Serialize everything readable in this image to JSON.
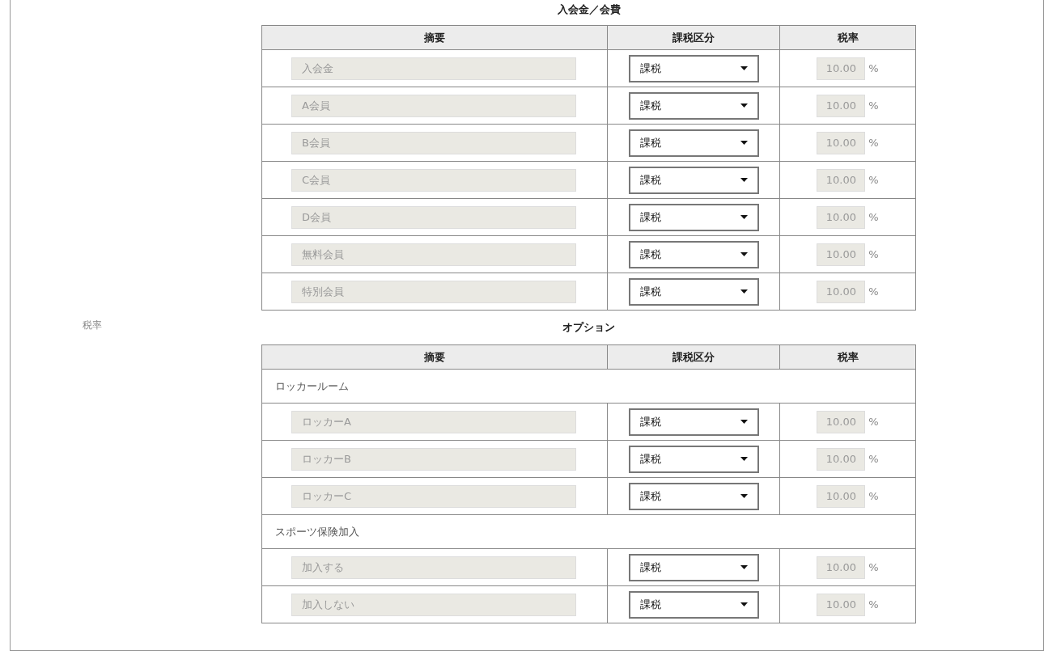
{
  "side_label": "税率",
  "sections": [
    {
      "title": "入会金／会費",
      "columns": [
        "摘要",
        "課税区分",
        "税率"
      ],
      "rows": [
        {
          "kind": "item",
          "name": "入会金",
          "tax_type": "課税",
          "rate": "10.00",
          "unit": "%"
        },
        {
          "kind": "item",
          "name": "A会員",
          "tax_type": "課税",
          "rate": "10.00",
          "unit": "%"
        },
        {
          "kind": "item",
          "name": "B会員",
          "tax_type": "課税",
          "rate": "10.00",
          "unit": "%"
        },
        {
          "kind": "item",
          "name": "C会員",
          "tax_type": "課税",
          "rate": "10.00",
          "unit": "%"
        },
        {
          "kind": "item",
          "name": "D会員",
          "tax_type": "課税",
          "rate": "10.00",
          "unit": "%"
        },
        {
          "kind": "item",
          "name": "無料会員",
          "tax_type": "課税",
          "rate": "10.00",
          "unit": "%"
        },
        {
          "kind": "item",
          "name": "特別会員",
          "tax_type": "課税",
          "rate": "10.00",
          "unit": "%"
        }
      ]
    },
    {
      "title": "オプション",
      "columns": [
        "摘要",
        "課税区分",
        "税率"
      ],
      "rows": [
        {
          "kind": "group",
          "label": "ロッカールーム"
        },
        {
          "kind": "item",
          "name": "ロッカーA",
          "tax_type": "課税",
          "rate": "10.00",
          "unit": "%"
        },
        {
          "kind": "item",
          "name": "ロッカーB",
          "tax_type": "課税",
          "rate": "10.00",
          "unit": "%"
        },
        {
          "kind": "item",
          "name": "ロッカーC",
          "tax_type": "課税",
          "rate": "10.00",
          "unit": "%"
        },
        {
          "kind": "group",
          "label": "スポーツ保険加入"
        },
        {
          "kind": "item",
          "name": "加入する",
          "tax_type": "課税",
          "rate": "10.00",
          "unit": "%"
        },
        {
          "kind": "item",
          "name": "加入しない",
          "tax_type": "課税",
          "rate": "10.00",
          "unit": "%"
        }
      ]
    }
  ]
}
